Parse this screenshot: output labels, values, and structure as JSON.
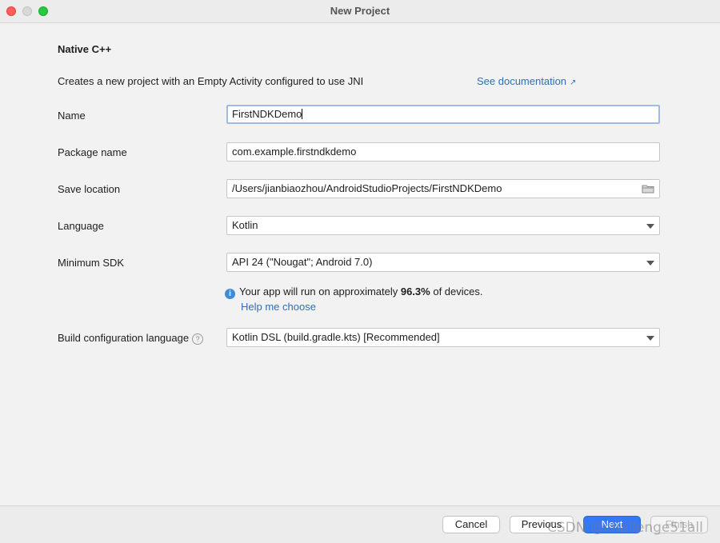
{
  "window": {
    "title": "New Project"
  },
  "page": {
    "heading": "Native C++",
    "description": "Creates a new project with an Empty Activity configured to use JNI",
    "doc_link": "See documentation",
    "doc_link_arrow": "↗"
  },
  "form": {
    "name_label": "Name",
    "name_value": "FirstNDKDemo",
    "package_label": "Package name",
    "package_value": "com.example.firstndkdemo",
    "save_label": "Save location",
    "save_value": "/Users/jianbiaozhou/AndroidStudioProjects/FirstNDKDemo",
    "language_label": "Language",
    "language_value": "Kotlin",
    "sdk_label": "Minimum SDK",
    "sdk_value": "API 24 (\"Nougat\"; Android 7.0)",
    "info_icon": "i",
    "info_prefix": "Your app will run on approximately ",
    "info_percent": "96.3%",
    "info_suffix": " of devices.",
    "help_link": "Help me choose",
    "build_label": "Build configuration language",
    "build_help_icon": "?",
    "build_value": "Kotlin DSL (build.gradle.kts) [Recommended]"
  },
  "footer": {
    "cancel": "Cancel",
    "previous": "Previous",
    "next": "Next",
    "finish": "Finish",
    "watermark": "CSDN @challenge51all"
  },
  "colors": {
    "accent": "#3478f6",
    "link": "#2f6dbd",
    "focus_border": "#9dbbe6"
  }
}
